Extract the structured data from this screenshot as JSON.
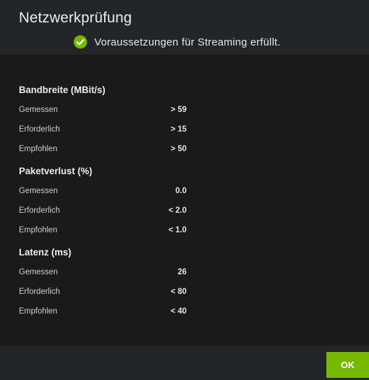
{
  "dialog": {
    "title": "Netzwerkprüfung",
    "status": {
      "icon": "check-circle-icon",
      "color": "#76b900",
      "text": "Voraussetzungen für Streaming erfüllt."
    }
  },
  "sections": [
    {
      "title": "Bandbreite (MBit/s)",
      "rows": [
        {
          "label": "Gemessen",
          "value": "> 59"
        },
        {
          "label": "Erforderlich",
          "value": "> 15"
        },
        {
          "label": "Empfohlen",
          "value": "> 50"
        }
      ]
    },
    {
      "title": "Paketverlust (%)",
      "rows": [
        {
          "label": "Gemessen",
          "value": "0.0"
        },
        {
          "label": "Erforderlich",
          "value": "< 2.0"
        },
        {
          "label": "Empfohlen",
          "value": "< 1.0"
        }
      ]
    },
    {
      "title": "Latenz (ms)",
      "rows": [
        {
          "label": "Gemessen",
          "value": "26"
        },
        {
          "label": "Erforderlich",
          "value": "< 80"
        },
        {
          "label": "Empfohlen",
          "value": "< 40"
        }
      ]
    }
  ],
  "footer": {
    "ok_label": "OK",
    "accent": "#76b900"
  }
}
